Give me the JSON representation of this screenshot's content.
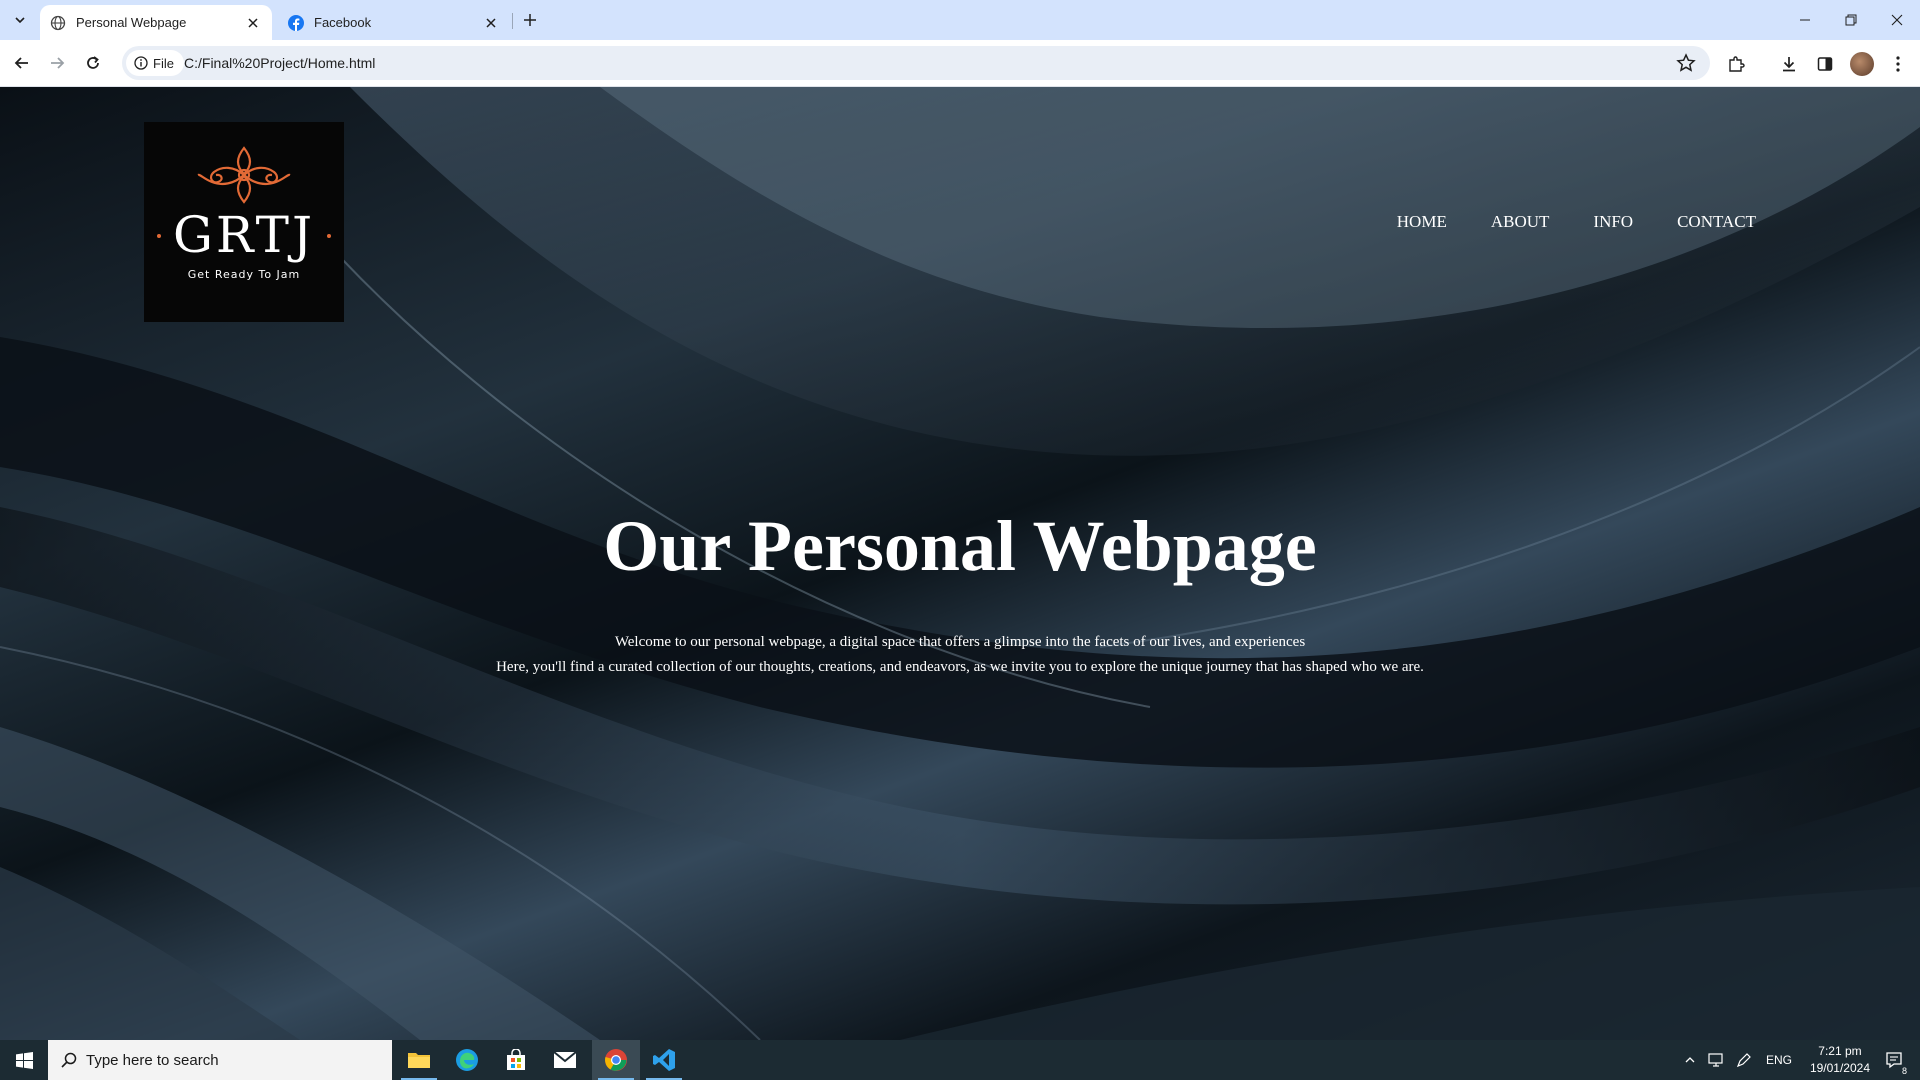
{
  "browser": {
    "tabs": [
      {
        "title": "Personal Webpage",
        "active": true
      },
      {
        "title": "Facebook",
        "active": false
      }
    ],
    "omnibox": {
      "chip_label": "File",
      "url": "C:/Final%20Project/Home.html"
    }
  },
  "page": {
    "logo": {
      "wordmark": "GRTJ",
      "tagline": "Get Ready To Jam",
      "accent_color": "#e26a36"
    },
    "nav": [
      "HOME",
      "ABOUT",
      "INFO",
      "CONTACT"
    ],
    "hero": {
      "title": "Our Personal Webpage",
      "line1": "Welcome to our personal webpage, a digital space that offers a glimpse into the facets of our lives, and experiences",
      "line2": "Here, you'll find a curated collection of our thoughts, creations, and endeavors, as we invite you to explore the unique journey that has shaped who we are."
    }
  },
  "taskbar": {
    "search_placeholder": "Type here to search",
    "apps": [
      "file-explorer",
      "edge",
      "store",
      "mail",
      "chrome",
      "vscode"
    ],
    "tray": {
      "language": "ENG",
      "time": "7:21 pm",
      "date": "19/01/2024",
      "notification_count": "8"
    }
  }
}
